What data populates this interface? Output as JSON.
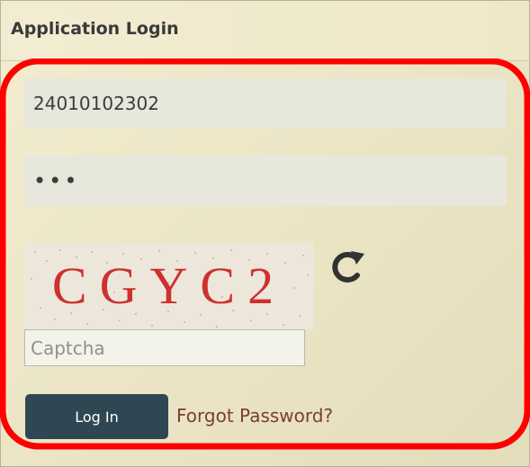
{
  "header": {
    "title": "Application Login"
  },
  "form": {
    "username_value": "24010102302",
    "password_masked": "•••",
    "captcha_text": "CGYC2",
    "captcha_placeholder": "Captcha",
    "login_label": "Log In",
    "forgot_label": "Forgot Password?"
  },
  "icons": {
    "refresh": "refresh-icon"
  },
  "colors": {
    "accent": "#2f4752",
    "link": "#7a3f2e",
    "highlight": "#ff0000",
    "captcha_text": "#cf2f2f"
  }
}
